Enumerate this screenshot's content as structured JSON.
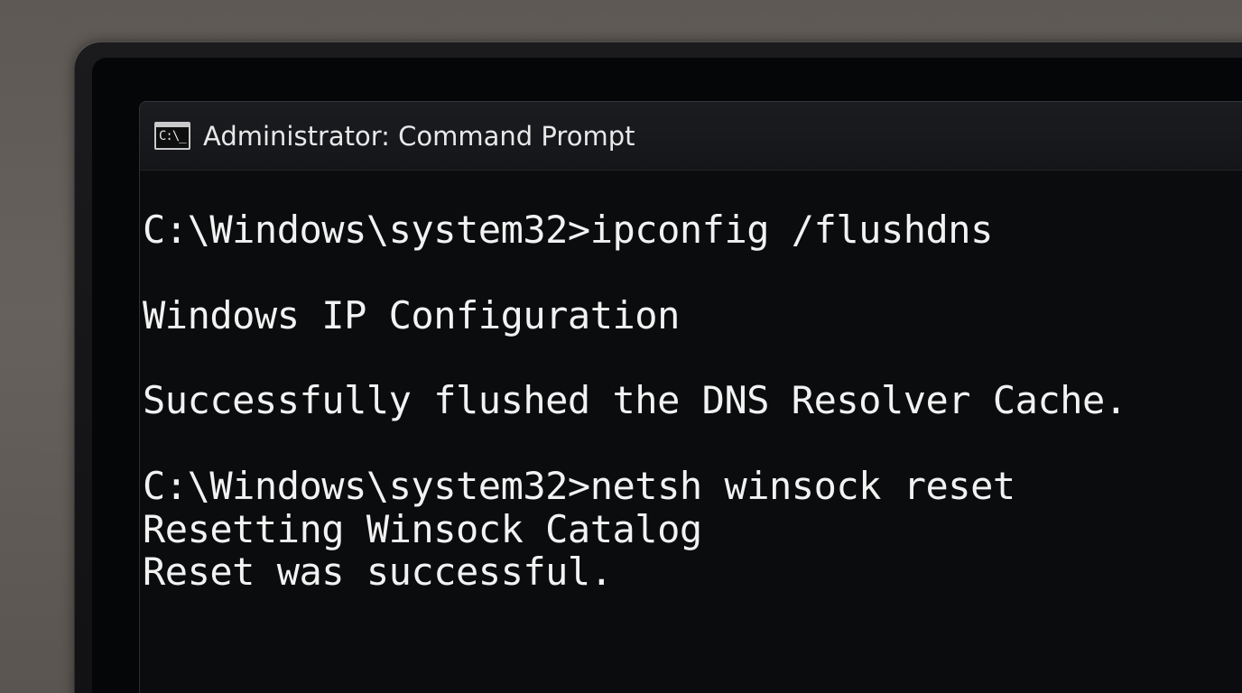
{
  "window": {
    "title": "Administrator: Command Prompt",
    "icon": "cmd-icon",
    "icon_text": "C:\\_"
  },
  "console": {
    "lines": [
      "C:\\Windows\\system32>ipconfig /flushdns",
      "Windows IP Configuration",
      "Successfully flushed the DNS Resolver Cache.",
      "C:\\Windows\\system32>netsh winsock reset",
      "Resetting Winsock Catalog",
      "Reset was successful."
    ]
  }
}
